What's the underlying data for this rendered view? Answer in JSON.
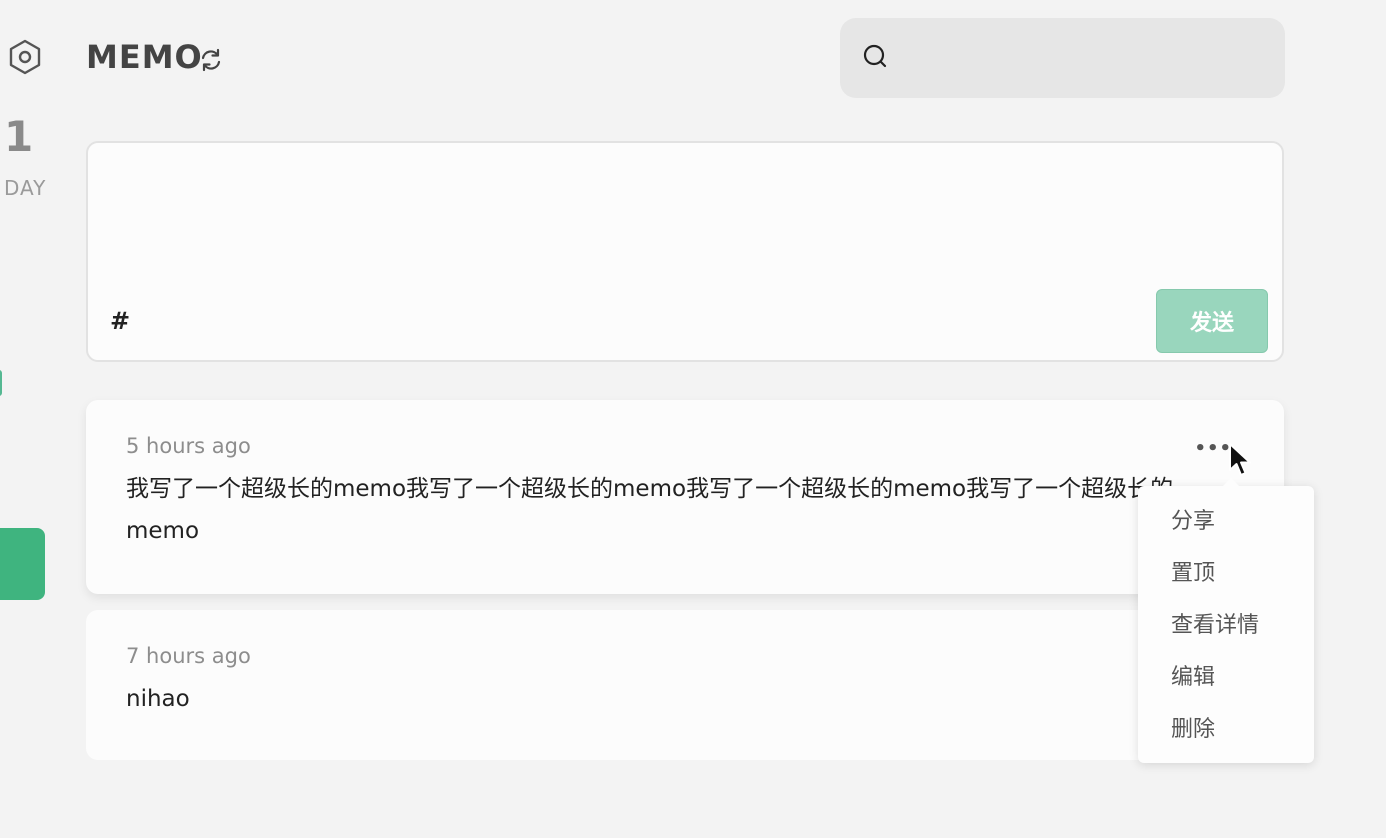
{
  "sidebar": {
    "count": "1",
    "count_label": "DAY"
  },
  "header": {
    "title": "MEMO"
  },
  "search": {
    "placeholder": ""
  },
  "editor": {
    "tag_hint": "#",
    "send_label": "发送"
  },
  "memos": [
    {
      "time": "5 hours ago",
      "content": "我写了一个超级长的memo我写了一个超级长的memo我写了一个超级长的memo我写了一个超级长的memo"
    },
    {
      "time": "7 hours ago",
      "content": "nihao"
    }
  ],
  "menu": {
    "items": [
      "分享",
      "置顶",
      "查看详情",
      "编辑",
      "删除"
    ]
  },
  "colors": {
    "accent": "#3fb47f",
    "send_button": "#99d6bd"
  },
  "icons": [
    "settings-hexagon-icon",
    "refresh-icon",
    "search-icon",
    "more-dots-icon",
    "cursor-icon"
  ]
}
